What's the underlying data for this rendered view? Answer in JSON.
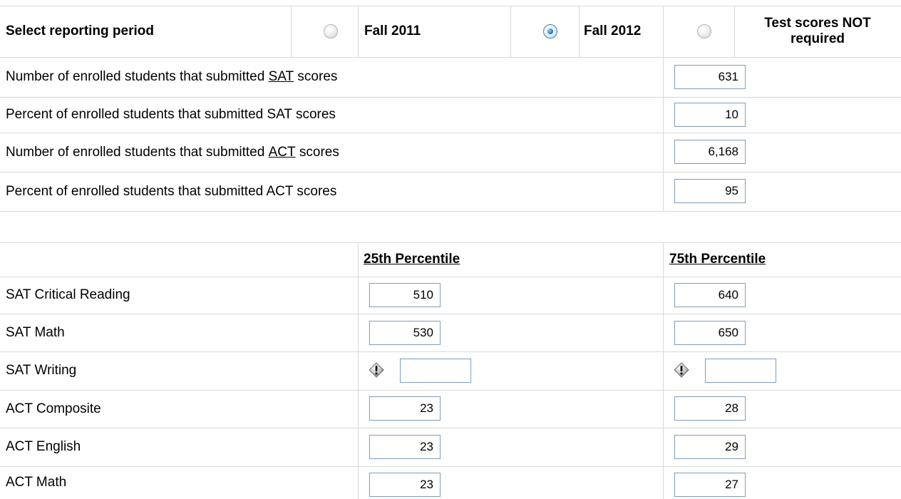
{
  "period": {
    "label": "Select reporting period",
    "options": [
      {
        "label": "Fall 2011",
        "selected": false
      },
      {
        "label": "Fall 2012",
        "selected": true
      },
      {
        "label": "Test scores NOT required",
        "selected": false
      }
    ]
  },
  "submissions": {
    "sat_count": {
      "prefix": "Number of enrolled students that submitted ",
      "link": "SAT",
      "suffix": " scores",
      "value": "631"
    },
    "sat_percent": {
      "label": "Percent of enrolled students that submitted SAT scores",
      "value": "10"
    },
    "act_count": {
      "prefix": "Number of enrolled students that submitted ",
      "link": "ACT",
      "suffix": " scores",
      "value": "6,168"
    },
    "act_percent": {
      "label": "Percent of enrolled students that submitted ACT scores",
      "value": "95"
    }
  },
  "percentiles": {
    "col25": "25th Percentile",
    "col75": "75th Percentile",
    "rows": [
      {
        "label": "SAT Critical Reading",
        "p25": "510",
        "p75": "640"
      },
      {
        "label": "SAT Math",
        "p25": "530",
        "p75": "650"
      },
      {
        "label": "SAT Writing",
        "p25": "",
        "p75": ""
      },
      {
        "label": "ACT Composite",
        "p25": "23",
        "p75": "28"
      },
      {
        "label": "ACT English",
        "p25": "23",
        "p75": "29"
      },
      {
        "label": "ACT Math",
        "p25": "23",
        "p75": "27"
      }
    ]
  },
  "icons": {
    "warning": "warning-icon",
    "radio": "radio-button"
  },
  "colors": {
    "grid": "#d9d9d9",
    "input_border": "#7f9db9",
    "radio_selected": "#2a7cc7"
  }
}
